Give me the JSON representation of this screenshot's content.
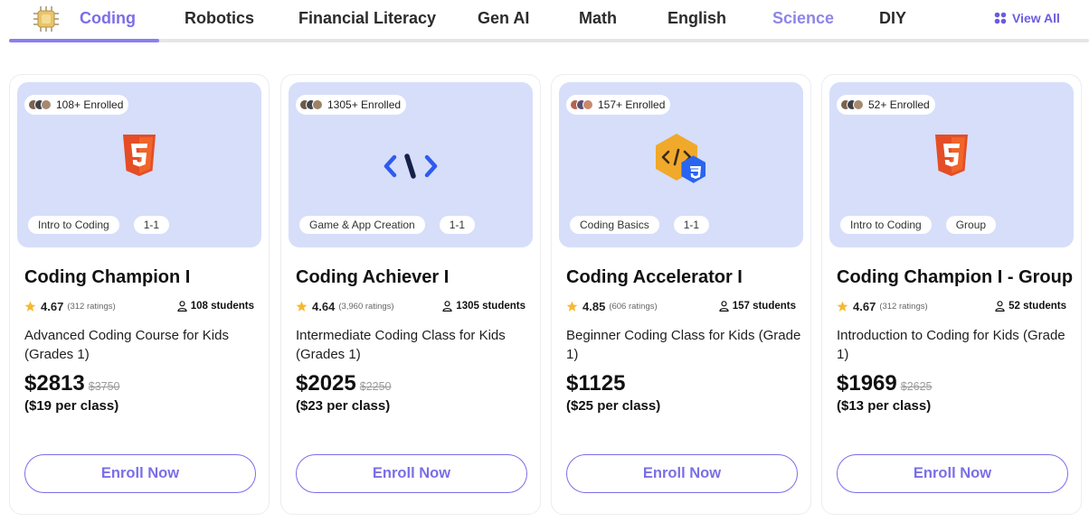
{
  "nav": {
    "logo_icon": "circuit-chip-icon",
    "items": [
      {
        "label": "Coding",
        "active": true
      },
      {
        "label": "Robotics"
      },
      {
        "label": "Financial Literacy"
      },
      {
        "label": "Gen AI"
      },
      {
        "label": "Math"
      },
      {
        "label": "English"
      },
      {
        "label": "Science"
      },
      {
        "label": "DIY"
      }
    ],
    "view_all": "View All",
    "view_all_icon": "grid-icon"
  },
  "colors": {
    "accent": "#7b6ee8",
    "hero_bg": "#d6defa",
    "star": "#f5b932"
  },
  "cards": [
    {
      "enrolled": "108+ Enrolled",
      "icon": "html5-icon",
      "tags": [
        "Intro to Coding",
        "1-1"
      ],
      "title": "Coding Champion I",
      "rating": "4.67",
      "ratings_count": "(312 ratings)",
      "students": "108 students",
      "description": "Advanced Coding Course for Kids (Grades 1)",
      "price": "$2813",
      "old_price": "$3750",
      "per_class": "($19 per class)",
      "cta": "Enroll Now"
    },
    {
      "enrolled": "1305+ Enrolled",
      "icon": "code-brackets-icon",
      "tags": [
        "Game & App Creation",
        "1-1"
      ],
      "title": "Coding Achiever I",
      "rating": "4.64",
      "ratings_count": "(3,960 ratings)",
      "students": "1305 students",
      "description": "Intermediate Coding Class for Kids (Grades 1)",
      "price": "$2025",
      "old_price": "$2250",
      "per_class": "($23 per class)",
      "cta": "Enroll Now"
    },
    {
      "enrolled": "157+ Enrolled",
      "icon": "code-hexagon-css-icon",
      "tags": [
        "Coding Basics",
        "1-1"
      ],
      "title": "Coding Accelerator I",
      "rating": "4.85",
      "ratings_count": "(606 ratings)",
      "students": "157 students",
      "description": "Beginner Coding Class for Kids (Grade 1)",
      "price": "$1125",
      "old_price": "",
      "per_class": "($25 per class)",
      "cta": "Enroll Now"
    },
    {
      "enrolled": "52+ Enrolled",
      "icon": "html5-icon",
      "tags": [
        "Intro to Coding",
        "Group"
      ],
      "title": "Coding Champion I - Group",
      "rating": "4.67",
      "ratings_count": "(312 ratings)",
      "students": "52 students",
      "description": "Introduction to Coding for Kids (Grade 1)",
      "price": "$1969",
      "old_price": "$2625",
      "per_class": "($13 per class)",
      "cta": "Enroll Now"
    }
  ]
}
